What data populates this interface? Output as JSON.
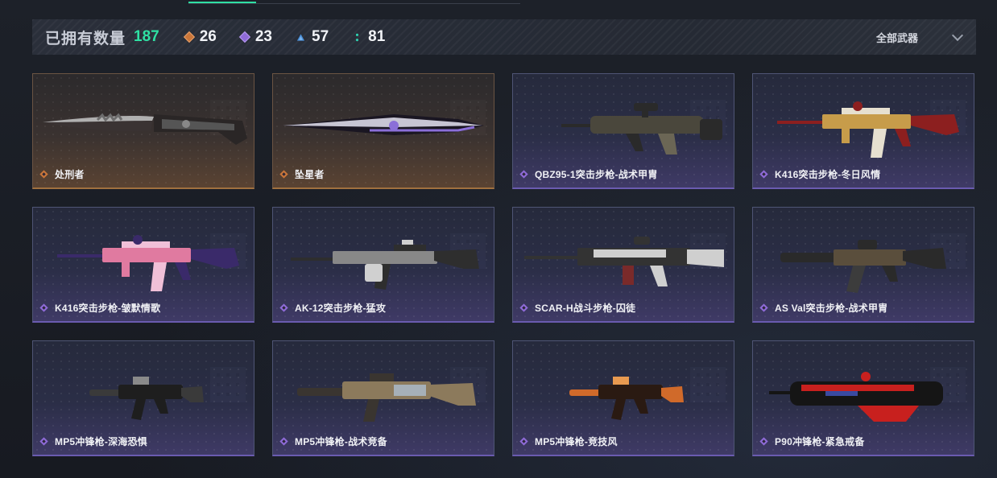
{
  "stats": {
    "owned_label": "已拥有数量",
    "owned_count": "187",
    "rarities": [
      {
        "icon": "orange-diamond-icon",
        "color": "#c9763a",
        "count": "26"
      },
      {
        "icon": "purple-diamond-icon",
        "color": "#8f6bd8",
        "count": "23"
      },
      {
        "icon": "blue-triangle-icon",
        "color": "#4a8fd8",
        "count": "57"
      },
      {
        "icon": "teal-dots-icon",
        "color": "#2fd0b0",
        "count": "81"
      }
    ]
  },
  "filter": {
    "label": "全部武器",
    "icon": "chevron-down-icon"
  },
  "colors": {
    "accent": "#2fe0a3",
    "purple_tier": "#8f6bd8",
    "orange_tier": "#c9763a"
  },
  "cards": [
    {
      "name": "处刑者",
      "tier": "orange",
      "weapon": "knife-jagged",
      "palette": [
        "#6d6d6d",
        "#b0b0b0",
        "#3a3333"
      ]
    },
    {
      "name": "坠星者",
      "tier": "orange",
      "weapon": "knife-dagger",
      "palette": [
        "#2b2540",
        "#8b6fd8",
        "#c7c5d3"
      ]
    },
    {
      "name": "QBZ95-1突击步枪-战术甲胄",
      "tier": "purple",
      "weapon": "bullpup",
      "palette": [
        "#2a2a2a",
        "#4a473c",
        "#6b6655"
      ]
    },
    {
      "name": "K416突击步枪-冬日风情",
      "tier": "purple",
      "weapon": "rifle",
      "palette": [
        "#8c1f1f",
        "#c79c4a",
        "#e6e0d0"
      ]
    },
    {
      "name": "K416突击步枪-皱默情歌",
      "tier": "purple",
      "weapon": "rifle",
      "palette": [
        "#3a2a6a",
        "#e07aa0",
        "#f0c0d8"
      ]
    },
    {
      "name": "AK-12突击步枪-猛攻",
      "tier": "purple",
      "weapon": "ak",
      "palette": [
        "#2e2e2e",
        "#888888",
        "#d0d0d0"
      ]
    },
    {
      "name": "SCAR-H战斗步枪-囚徒",
      "tier": "purple",
      "weapon": "scar",
      "palette": [
        "#333333",
        "#cfcfcf",
        "#7a2a2a"
      ]
    },
    {
      "name": "AS Val突击步枪-战术甲胄",
      "tier": "purple",
      "weapon": "asval",
      "palette": [
        "#2a2a2a",
        "#5a4e3c",
        "#3c3c3c"
      ]
    },
    {
      "name": "MP5冲锋枪-深海恐惧",
      "tier": "purple",
      "weapon": "mp5",
      "palette": [
        "#1e1e1e",
        "#3a3a3a",
        "#8a8a8a"
      ]
    },
    {
      "name": "MP5冲锋枪-战术竞备",
      "tier": "purple",
      "weapon": "mp5-tac",
      "palette": [
        "#3a3530",
        "#8c7a5c",
        "#a6b0b8"
      ]
    },
    {
      "name": "MP5冲锋枪-竞技风",
      "tier": "purple",
      "weapon": "mp5",
      "palette": [
        "#2a1a12",
        "#d06a2a",
        "#e89a50"
      ]
    },
    {
      "name": "P90冲锋枪-紧急戒备",
      "tier": "purple",
      "weapon": "p90",
      "palette": [
        "#151515",
        "#c8201e",
        "#3a4aa0"
      ]
    }
  ]
}
